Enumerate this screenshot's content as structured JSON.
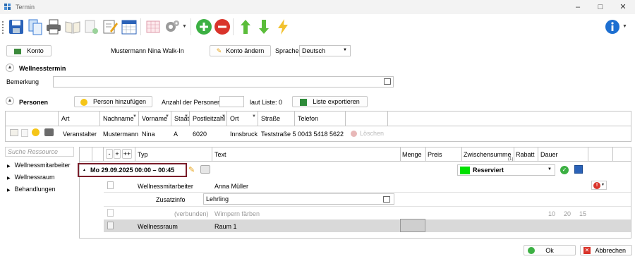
{
  "window": {
    "title": "Termin"
  },
  "header": {
    "konto_button": "Konto",
    "customer_name": "Mustermann Nina Walk-In",
    "konto_aendern": "Konto ändern",
    "sprache_label": "Sprache",
    "sprache_value": "Deutsch"
  },
  "wellness": {
    "section_title": "Wellnesstermin",
    "bemerkung_label": "Bemerkung",
    "bemerkung_value": ""
  },
  "personen": {
    "section_title": "Personen",
    "add_person": "Person hinzufügen",
    "anzahl_label": "Anzahl der Personen",
    "anzahl_value": "",
    "laut_liste": "laut Liste: 0",
    "export_button": "Liste exportieren",
    "columns": [
      "Art",
      "Nachname",
      "Vorname",
      "Staat",
      "Postleitzahl",
      "Ort",
      "Straße",
      "Telefon"
    ],
    "row": {
      "art": "Veranstalter",
      "nachname": "Mustermann",
      "vorname": "Nina",
      "staat": "A",
      "plz": "6020",
      "ort": "Innsbruck",
      "strasse": "Teststraße 5",
      "telefon": "0043 5418 5622"
    },
    "loeschen": "Löschen"
  },
  "resources": {
    "search_placeholder": "Suche Ressource",
    "items": [
      "Wellnessmitarbeiter",
      "Wellnessraum",
      "Behandlungen"
    ]
  },
  "booking": {
    "btn_minus": "-",
    "btn_plus": "+",
    "btn_plusplus": "++",
    "columns": {
      "typ": "Typ",
      "text": "Text",
      "menge": "Menge",
      "preis": "Preis",
      "zwischensumme": "Zwischensumme",
      "zw_sub": "(1)",
      "rabatt": "Rabatt",
      "dauer": "Dauer"
    },
    "date_row": "Mo 29.09.2025 00:00 – 00:45",
    "status": "Reserviert",
    "status_color": "#00e000",
    "rows": [
      {
        "typ": "Wellnessmitarbeiter",
        "text": "Anna Müller"
      },
      {
        "zusatz_label": "Zusatzinfo",
        "zusatz_value": "Lehrling"
      },
      {
        "typ": "(verbunden)",
        "text": "Wimpern färben",
        "d1": "10",
        "d2": "20",
        "d3": "15"
      },
      {
        "typ": "Wellnessraum",
        "text": "Raum 1"
      }
    ]
  },
  "footer": {
    "ok": "Ok",
    "abbrechen": "Abbrechen"
  },
  "colors": {
    "highlight_border": "#7a1d2a",
    "green": "#3cb043",
    "red": "#d9342b",
    "blue_info": "#1d6fd1"
  }
}
